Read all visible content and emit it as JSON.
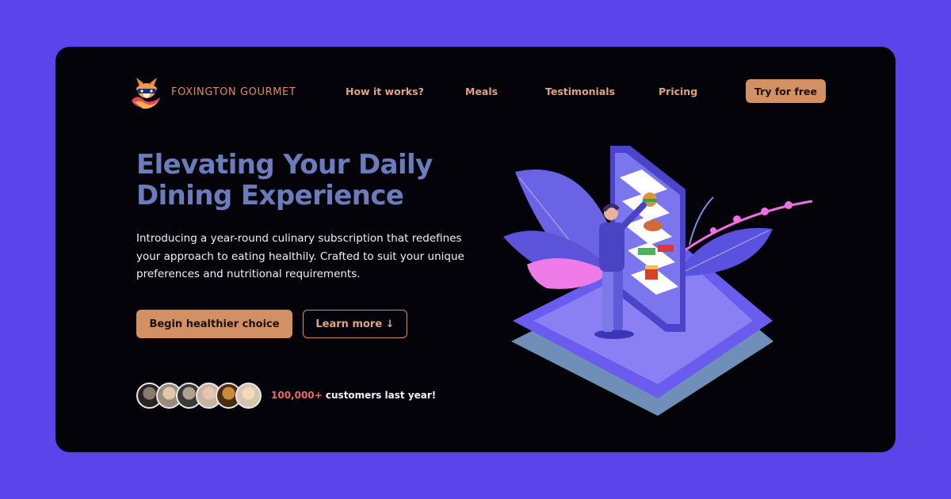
{
  "brand": {
    "name": "FOXINGTON GOURMET",
    "logo_icon": "fox-logo-icon"
  },
  "nav": {
    "links": [
      "How it works?",
      "Meals",
      "Testimonials",
      "Pricing"
    ],
    "cta_label": "Try for free"
  },
  "hero": {
    "title": "Elevating Your Daily Dining Experience",
    "description": "Introducing a year-round culinary subscription that redefines your approach to eating healthily. Crafted to suit your unique preferences and nutritional requirements.",
    "primary_button": "Begin healthier choice",
    "secondary_button": "Learn more ↓"
  },
  "social_proof": {
    "count": "100,000+",
    "text": " customers last year!",
    "avatars": [
      "customer-avatar-1",
      "customer-avatar-2",
      "customer-avatar-3",
      "customer-avatar-4",
      "customer-avatar-5",
      "customer-avatar-6"
    ]
  },
  "colors": {
    "page_background": "#5b45ea",
    "card_background": "#04030a",
    "accent": "#d39062",
    "title": "#6a7cbb",
    "highlight": "#ef6a5a"
  }
}
